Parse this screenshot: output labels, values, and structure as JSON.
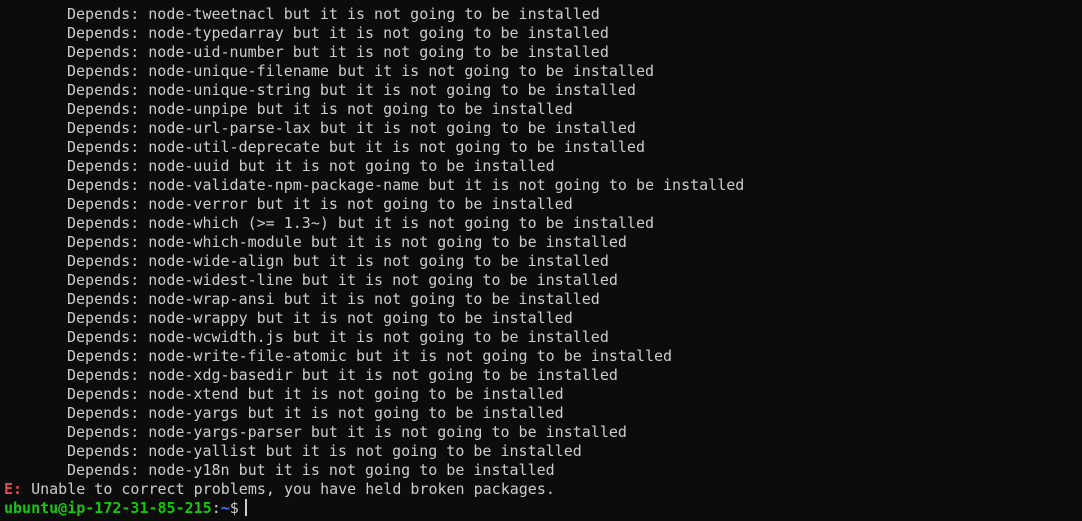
{
  "terminal": {
    "depends_lines": [
      "Depends: node-tweetnacl but it is not going to be installed",
      "Depends: node-typedarray but it is not going to be installed",
      "Depends: node-uid-number but it is not going to be installed",
      "Depends: node-unique-filename but it is not going to be installed",
      "Depends: node-unique-string but it is not going to be installed",
      "Depends: node-unpipe but it is not going to be installed",
      "Depends: node-url-parse-lax but it is not going to be installed",
      "Depends: node-util-deprecate but it is not going to be installed",
      "Depends: node-uuid but it is not going to be installed",
      "Depends: node-validate-npm-package-name but it is not going to be installed",
      "Depends: node-verror but it is not going to be installed",
      "Depends: node-which (>= 1.3~) but it is not going to be installed",
      "Depends: node-which-module but it is not going to be installed",
      "Depends: node-wide-align but it is not going to be installed",
      "Depends: node-widest-line but it is not going to be installed",
      "Depends: node-wrap-ansi but it is not going to be installed",
      "Depends: node-wrappy but it is not going to be installed",
      "Depends: node-wcwidth.js but it is not going to be installed",
      "Depends: node-write-file-atomic but it is not going to be installed",
      "Depends: node-xdg-basedir but it is not going to be installed",
      "Depends: node-xtend but it is not going to be installed",
      "Depends: node-yargs but it is not going to be installed",
      "Depends: node-yargs-parser but it is not going to be installed",
      "Depends: node-yallist but it is not going to be installed",
      "Depends: node-y18n but it is not going to be installed"
    ],
    "error": {
      "prefix": "E:",
      "message": " Unable to correct problems, you have held broken packages."
    },
    "prompt": {
      "user_host": "ubuntu@ip-172-31-85-215",
      "separator": ":",
      "path": "~",
      "symbol": "$"
    },
    "colors": {
      "background": "#0c0c0c",
      "text": "#cccccc",
      "error": "#e74856",
      "prompt_user": "#16c60c",
      "prompt_path": "#3b78ff"
    }
  }
}
